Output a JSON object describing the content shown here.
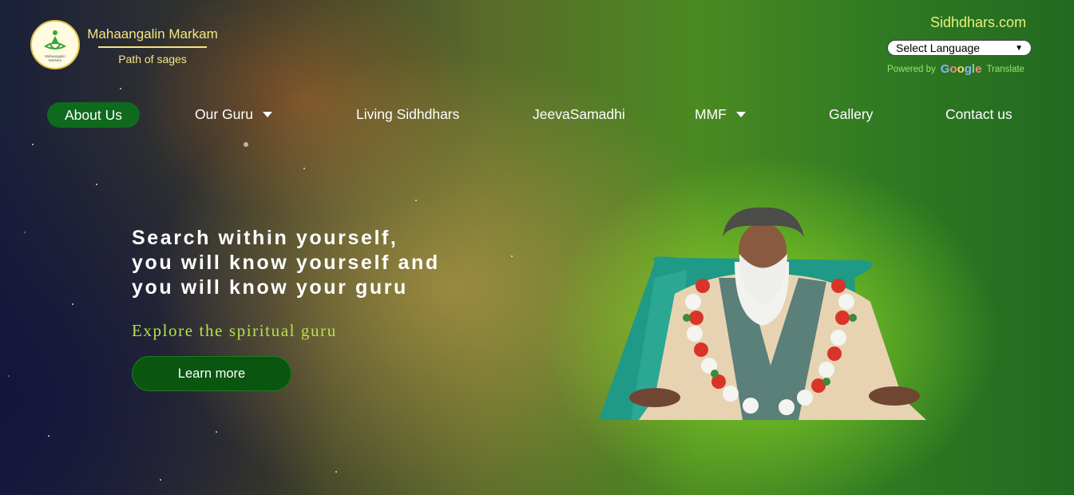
{
  "header": {
    "brand_name": "Mahaangalin Markam",
    "tagline": "Path of sages",
    "logo_text_1": "Mahaangalin",
    "logo_text_2": "Markam",
    "site_name": "Sidhdhars.com",
    "language_select": "Select Language",
    "powered_by": "Powered by",
    "google": "Google",
    "translate": "Translate"
  },
  "nav": [
    {
      "label": "About Us",
      "active": true
    },
    {
      "label": "Our Guru",
      "dropdown": true
    },
    {
      "label": "Living Sidhdhars"
    },
    {
      "label": "JeevaSamadhi"
    },
    {
      "label": "MMF",
      "dropdown": true
    },
    {
      "label": "Gallery"
    },
    {
      "label": "Contact us"
    }
  ],
  "hero": {
    "line1": "Search within yourself,",
    "line2": "you will know yourself and",
    "line3": "you will know your guru",
    "subtitle": "Explore the spiritual guru",
    "button": "Learn more"
  },
  "colors": {
    "accent_green": "#0f6a1d",
    "button_green": "#0a5510",
    "brand_yellow": "#f3e585",
    "subtitle_green": "#b6e24a"
  }
}
